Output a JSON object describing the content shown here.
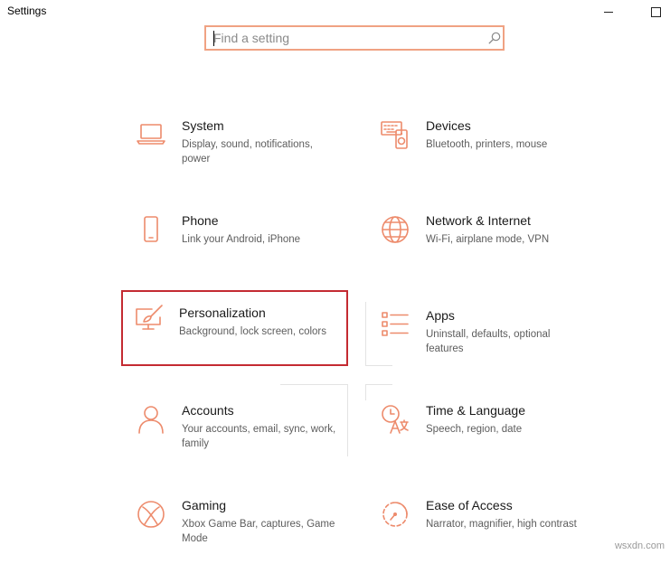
{
  "window": {
    "title": "Settings"
  },
  "search": {
    "placeholder": "Find a setting",
    "value": ""
  },
  "tiles": [
    {
      "title": "System",
      "desc": "Display, sound, notifications, power"
    },
    {
      "title": "Devices",
      "desc": "Bluetooth, printers, mouse"
    },
    {
      "title": "Phone",
      "desc": "Link your Android, iPhone"
    },
    {
      "title": "Network & Internet",
      "desc": "Wi-Fi, airplane mode, VPN"
    },
    {
      "title": "Personalization",
      "desc": "Background, lock screen, colors"
    },
    {
      "title": "Apps",
      "desc": "Uninstall, defaults, optional features"
    },
    {
      "title": "Accounts",
      "desc": "Your accounts, email, sync, work, family"
    },
    {
      "title": "Time & Language",
      "desc": "Speech, region, date"
    },
    {
      "title": "Gaming",
      "desc": "Xbox Game Bar, captures, Game Mode"
    },
    {
      "title": "Ease of Access",
      "desc": "Narrator, magnifier, high contrast"
    }
  ],
  "selected_tile": "Personalization",
  "watermark": "wsxdn.com",
  "colors": {
    "accent": "#ed8b6c",
    "selection": "#c42b32",
    "search_border": "#f0a283"
  }
}
